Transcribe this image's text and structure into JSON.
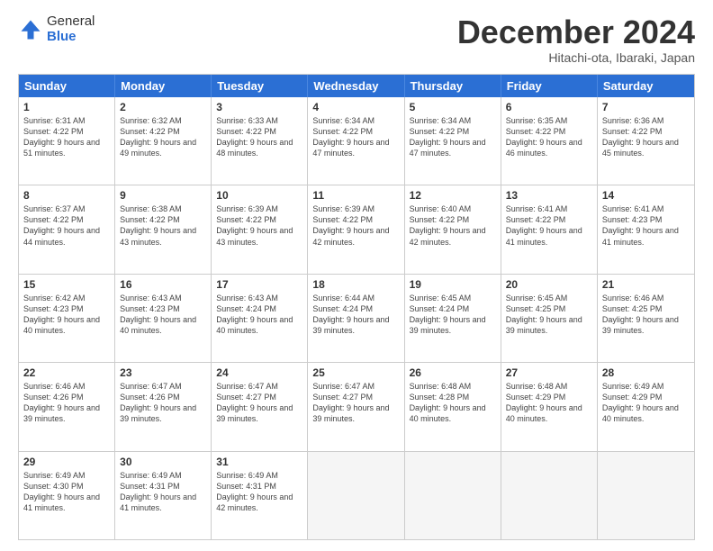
{
  "logo": {
    "general": "General",
    "blue": "Blue"
  },
  "header": {
    "month": "December 2024",
    "location": "Hitachi-ota, Ibaraki, Japan"
  },
  "weekdays": [
    "Sunday",
    "Monday",
    "Tuesday",
    "Wednesday",
    "Thursday",
    "Friday",
    "Saturday"
  ],
  "weeks": [
    [
      {
        "day": "1",
        "sunrise": "6:31 AM",
        "sunset": "4:22 PM",
        "daylight": "9 hours and 51 minutes."
      },
      {
        "day": "2",
        "sunrise": "6:32 AM",
        "sunset": "4:22 PM",
        "daylight": "9 hours and 49 minutes."
      },
      {
        "day": "3",
        "sunrise": "6:33 AM",
        "sunset": "4:22 PM",
        "daylight": "9 hours and 48 minutes."
      },
      {
        "day": "4",
        "sunrise": "6:34 AM",
        "sunset": "4:22 PM",
        "daylight": "9 hours and 47 minutes."
      },
      {
        "day": "5",
        "sunrise": "6:34 AM",
        "sunset": "4:22 PM",
        "daylight": "9 hours and 47 minutes."
      },
      {
        "day": "6",
        "sunrise": "6:35 AM",
        "sunset": "4:22 PM",
        "daylight": "9 hours and 46 minutes."
      },
      {
        "day": "7",
        "sunrise": "6:36 AM",
        "sunset": "4:22 PM",
        "daylight": "9 hours and 45 minutes."
      }
    ],
    [
      {
        "day": "8",
        "sunrise": "6:37 AM",
        "sunset": "4:22 PM",
        "daylight": "9 hours and 44 minutes."
      },
      {
        "day": "9",
        "sunrise": "6:38 AM",
        "sunset": "4:22 PM",
        "daylight": "9 hours and 43 minutes."
      },
      {
        "day": "10",
        "sunrise": "6:39 AM",
        "sunset": "4:22 PM",
        "daylight": "9 hours and 43 minutes."
      },
      {
        "day": "11",
        "sunrise": "6:39 AM",
        "sunset": "4:22 PM",
        "daylight": "9 hours and 42 minutes."
      },
      {
        "day": "12",
        "sunrise": "6:40 AM",
        "sunset": "4:22 PM",
        "daylight": "9 hours and 42 minutes."
      },
      {
        "day": "13",
        "sunrise": "6:41 AM",
        "sunset": "4:22 PM",
        "daylight": "9 hours and 41 minutes."
      },
      {
        "day": "14",
        "sunrise": "6:41 AM",
        "sunset": "4:23 PM",
        "daylight": "9 hours and 41 minutes."
      }
    ],
    [
      {
        "day": "15",
        "sunrise": "6:42 AM",
        "sunset": "4:23 PM",
        "daylight": "9 hours and 40 minutes."
      },
      {
        "day": "16",
        "sunrise": "6:43 AM",
        "sunset": "4:23 PM",
        "daylight": "9 hours and 40 minutes."
      },
      {
        "day": "17",
        "sunrise": "6:43 AM",
        "sunset": "4:24 PM",
        "daylight": "9 hours and 40 minutes."
      },
      {
        "day": "18",
        "sunrise": "6:44 AM",
        "sunset": "4:24 PM",
        "daylight": "9 hours and 39 minutes."
      },
      {
        "day": "19",
        "sunrise": "6:45 AM",
        "sunset": "4:24 PM",
        "daylight": "9 hours and 39 minutes."
      },
      {
        "day": "20",
        "sunrise": "6:45 AM",
        "sunset": "4:25 PM",
        "daylight": "9 hours and 39 minutes."
      },
      {
        "day": "21",
        "sunrise": "6:46 AM",
        "sunset": "4:25 PM",
        "daylight": "9 hours and 39 minutes."
      }
    ],
    [
      {
        "day": "22",
        "sunrise": "6:46 AM",
        "sunset": "4:26 PM",
        "daylight": "9 hours and 39 minutes."
      },
      {
        "day": "23",
        "sunrise": "6:47 AM",
        "sunset": "4:26 PM",
        "daylight": "9 hours and 39 minutes."
      },
      {
        "day": "24",
        "sunrise": "6:47 AM",
        "sunset": "4:27 PM",
        "daylight": "9 hours and 39 minutes."
      },
      {
        "day": "25",
        "sunrise": "6:47 AM",
        "sunset": "4:27 PM",
        "daylight": "9 hours and 39 minutes."
      },
      {
        "day": "26",
        "sunrise": "6:48 AM",
        "sunset": "4:28 PM",
        "daylight": "9 hours and 40 minutes."
      },
      {
        "day": "27",
        "sunrise": "6:48 AM",
        "sunset": "4:29 PM",
        "daylight": "9 hours and 40 minutes."
      },
      {
        "day": "28",
        "sunrise": "6:49 AM",
        "sunset": "4:29 PM",
        "daylight": "9 hours and 40 minutes."
      }
    ],
    [
      {
        "day": "29",
        "sunrise": "6:49 AM",
        "sunset": "4:30 PM",
        "daylight": "9 hours and 41 minutes."
      },
      {
        "day": "30",
        "sunrise": "6:49 AM",
        "sunset": "4:31 PM",
        "daylight": "9 hours and 41 minutes."
      },
      {
        "day": "31",
        "sunrise": "6:49 AM",
        "sunset": "4:31 PM",
        "daylight": "9 hours and 42 minutes."
      },
      null,
      null,
      null,
      null
    ]
  ]
}
